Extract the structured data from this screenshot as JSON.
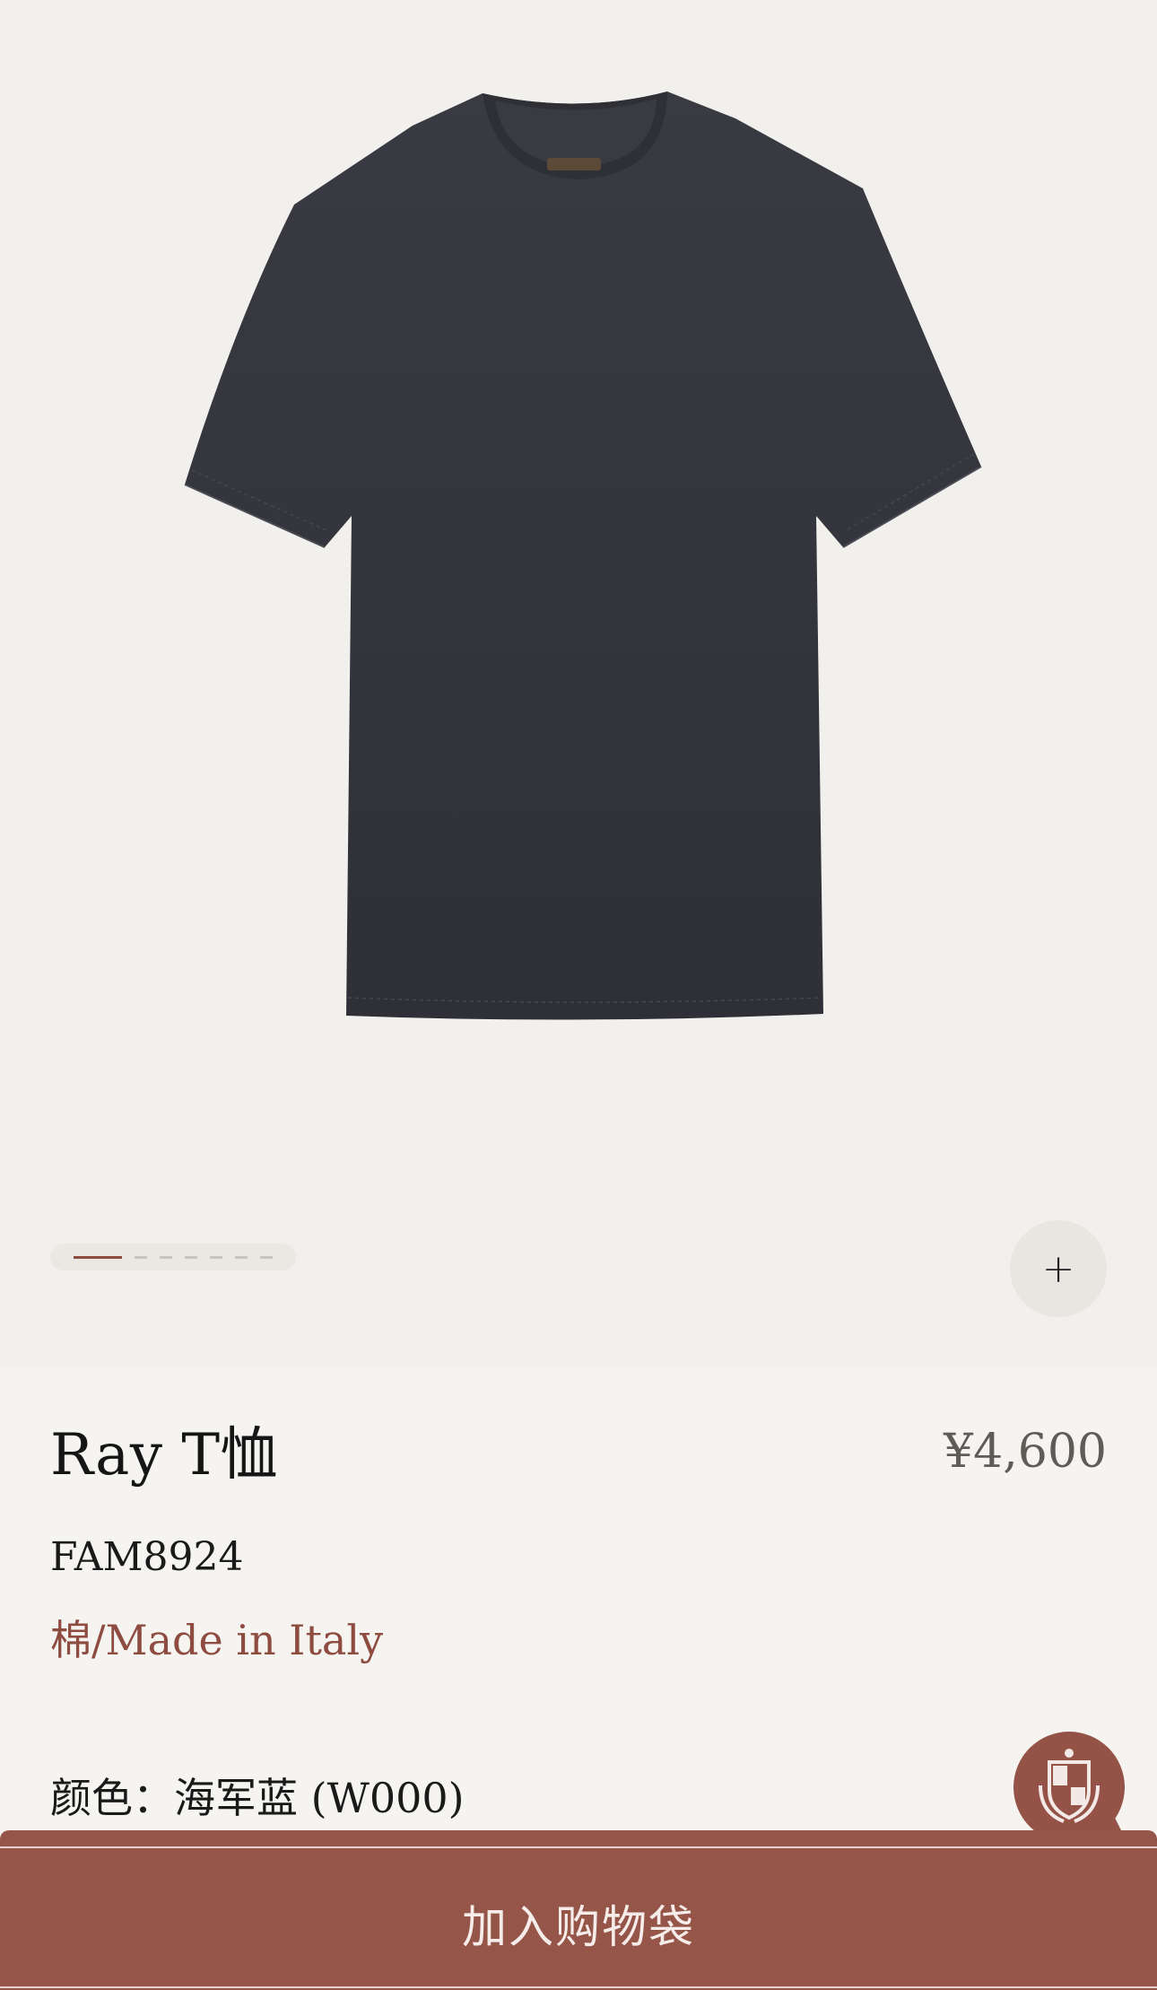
{
  "gallery": {
    "image_alt": "Ray T恤",
    "pager_total": 7,
    "pager_active_index": 0,
    "zoom_icon": "plus-icon",
    "zoom_symbol": "+"
  },
  "product": {
    "title": "Ray T恤",
    "price": "¥4,600",
    "sku": "FAM8924",
    "material": "棉/Made in Italy",
    "color_label": "颜色：",
    "color_value": "海军蓝 (W000)"
  },
  "chat": {
    "icon": "brand-crest-chat-icon"
  },
  "cart": {
    "add_label": "加入购物袋"
  },
  "colors": {
    "accent": "#8e4b40",
    "cart_bar": "#955549",
    "background": "#f5f4f1",
    "gallery_bg": "#f2f0ed",
    "shirt": "#34353c"
  }
}
